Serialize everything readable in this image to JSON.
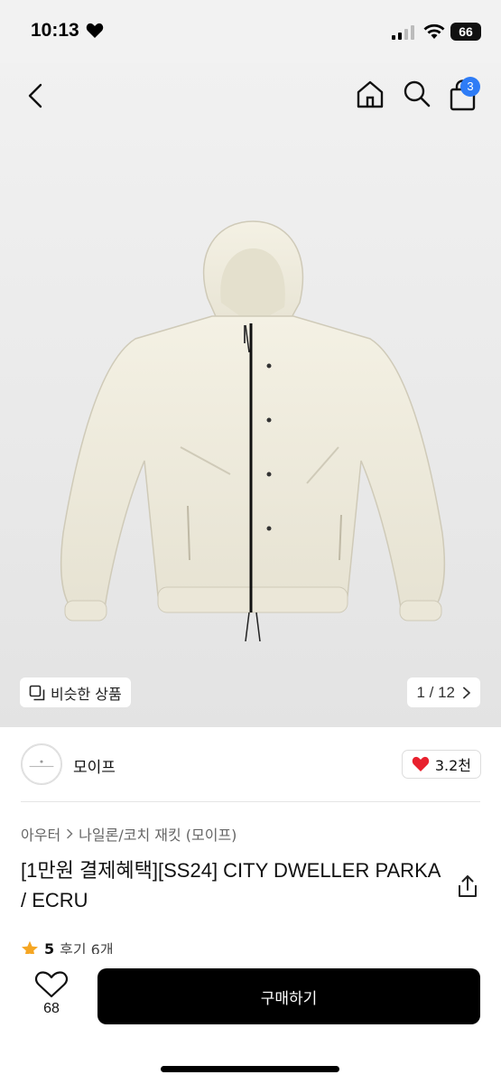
{
  "status_bar": {
    "time": "10:13",
    "battery": "66"
  },
  "nav": {
    "cart_count": "3"
  },
  "gallery": {
    "similar_label": "비슷한 상품",
    "counter": "1 / 12"
  },
  "seller": {
    "name": "모이프",
    "like_count": "3.2천"
  },
  "product": {
    "category_parent": "아우터",
    "category_child": "나일론/코치 재킷 (모이프)",
    "title": "[1만원 결제혜택][SS24] CITY DWELLER PARKA / ECRU",
    "rating": "5",
    "review_label": "후기 6개"
  },
  "bottom": {
    "wish_count": "68",
    "buy_label": "구매하기"
  },
  "colors": {
    "accent_blue": "#2e7cf6",
    "heart_red": "#e8212e",
    "star": "#f5a623"
  },
  "icons": [
    "heart-icon",
    "signal-icon",
    "wifi-icon",
    "back-icon",
    "home-icon",
    "search-icon",
    "bag-icon",
    "similar-icon",
    "chevron-right-icon",
    "share-icon",
    "star-icon",
    "wish-heart-icon"
  ]
}
